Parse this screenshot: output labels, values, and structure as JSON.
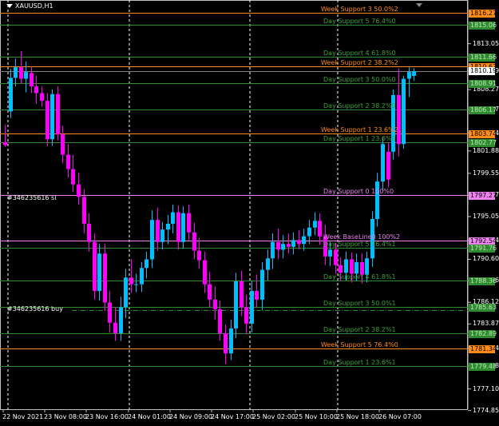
{
  "symbol": "XAUUSD,H1",
  "colors": {
    "background": "#000000",
    "bull": "#00BFFF",
    "bear": "#FF00FF",
    "week": "#FF8C1A",
    "day": "#2E8B2E",
    "pivot": "#EE82EE",
    "grid": "#FFFFFF"
  },
  "order_labels": {
    "sl": "#346235616 sl",
    "buy": "#346235616 buy"
  },
  "levels": [
    {
      "label": "Week Support 3 50.0%2",
      "price": "1816.27",
      "kind": "week"
    },
    {
      "label": "Day Support 5 76.4%0",
      "price": "1815.06",
      "kind": "day"
    },
    {
      "label": "Day Support 4 61.8%0",
      "price": "1811.66",
      "kind": "day"
    },
    {
      "label": "Week Support 2 38.2%2",
      "price": "1810.67",
      "kind": "week"
    },
    {
      "label": "Day Support 3 50.0%0",
      "price": "1808.91",
      "kind": "day"
    },
    {
      "label": "Day Support 2 38.2%0",
      "price": "1806.17",
      "kind": "day"
    },
    {
      "label": "Week Support 1 23.6%2",
      "price": "1803.74",
      "kind": "week"
    },
    {
      "label": "Day Support 1 23.6%0",
      "price": "1802.77",
      "kind": "day"
    },
    {
      "label": "Day Support 0 100%0",
      "price": "1797.27",
      "kind": "pivot"
    },
    {
      "label": "Week BaseLine0 100%2",
      "price": "1792.54",
      "kind": "pivot"
    },
    {
      "label": "Day Support 5 76.4%1",
      "price": "1791.76",
      "kind": "day"
    },
    {
      "label": "Day Support 4 61.8%1",
      "price": "1788.36",
      "kind": "day"
    },
    {
      "label": "Day Support 3 50.0%1",
      "price": "1785.63",
      "kind": "day"
    },
    {
      "label": "Day Support 2 38.2%1",
      "price": "1782.89",
      "kind": "day"
    },
    {
      "label": "Week Support 5 76.4%0",
      "price": "1781.34",
      "kind": "week"
    },
    {
      "label": "Day Support 1 23.6%1",
      "price": "1779.48",
      "kind": "day"
    }
  ],
  "current_price": "1810.19",
  "price_axis": [
    "1813.05",
    "1810.19",
    "1808.27",
    "1806.17",
    "1803.74",
    "1801.88",
    "1799.55",
    "1797.27",
    "1795.05",
    "1792.54",
    "1790.60",
    "1788.36",
    "1786.12",
    "1783.87",
    "1781.34",
    "1779.48",
    "1777.10",
    "1774.85"
  ],
  "time_axis": [
    "22 Nov 2021",
    "23 Nov 08:00",
    "23 Nov 16:00",
    "24 Nov 01:00",
    "24 Nov 09:00",
    "24 Nov 17:00",
    "25 Nov 02:00",
    "25 Nov 10:00",
    "25 Nov 18:00",
    "26 Nov 07:00"
  ],
  "chart_data": {
    "type": "candlestick",
    "symbol": "XAUUSD,H1",
    "candles": [
      {
        "o": 1802.8,
        "h": 1804.6,
        "l": 1802.3,
        "c": 1802.5
      },
      {
        "o": 1806.0,
        "h": 1810.4,
        "l": 1805.3,
        "c": 1809.5
      },
      {
        "o": 1809.5,
        "h": 1811.5,
        "l": 1808.6,
        "c": 1810.6
      },
      {
        "o": 1810.6,
        "h": 1812.3,
        "l": 1808.9,
        "c": 1809.4
      },
      {
        "o": 1809.4,
        "h": 1811.2,
        "l": 1808.0,
        "c": 1810.1
      },
      {
        "o": 1810.0,
        "h": 1810.6,
        "l": 1807.9,
        "c": 1808.6
      },
      {
        "o": 1808.6,
        "h": 1809.7,
        "l": 1806.8,
        "c": 1807.9
      },
      {
        "o": 1807.9,
        "h": 1808.6,
        "l": 1806.5,
        "c": 1807.1
      },
      {
        "o": 1807.1,
        "h": 1807.9,
        "l": 1802.4,
        "c": 1803.1
      },
      {
        "o": 1803.1,
        "h": 1808.3,
        "l": 1802.4,
        "c": 1807.8
      },
      {
        "o": 1807.8,
        "h": 1808.6,
        "l": 1803.0,
        "c": 1803.6
      },
      {
        "o": 1803.6,
        "h": 1804.5,
        "l": 1800.6,
        "c": 1801.5
      },
      {
        "o": 1801.5,
        "h": 1802.6,
        "l": 1799.1,
        "c": 1800.0
      },
      {
        "o": 1800.0,
        "h": 1801.5,
        "l": 1797.6,
        "c": 1798.4
      },
      {
        "o": 1798.4,
        "h": 1799.6,
        "l": 1796.3,
        "c": 1797.1
      },
      {
        "o": 1797.1,
        "h": 1797.9,
        "l": 1793.3,
        "c": 1794.3
      },
      {
        "o": 1794.3,
        "h": 1795.4,
        "l": 1791.4,
        "c": 1792.4
      },
      {
        "o": 1792.4,
        "h": 1793.3,
        "l": 1786.4,
        "c": 1787.3
      },
      {
        "o": 1787.3,
        "h": 1792.2,
        "l": 1786.3,
        "c": 1791.2
      },
      {
        "o": 1791.2,
        "h": 1792.2,
        "l": 1785.2,
        "c": 1786.1
      },
      {
        "o": 1786.1,
        "h": 1787.3,
        "l": 1783.0,
        "c": 1784.0
      },
      {
        "o": 1784.0,
        "h": 1785.6,
        "l": 1782.1,
        "c": 1782.9
      },
      {
        "o": 1782.9,
        "h": 1786.7,
        "l": 1782.1,
        "c": 1785.6
      },
      {
        "o": 1785.6,
        "h": 1789.6,
        "l": 1784.5,
        "c": 1788.7
      },
      {
        "o": 1788.7,
        "h": 1790.6,
        "l": 1787.1,
        "c": 1788.0
      },
      {
        "o": 1788.0,
        "h": 1789.1,
        "l": 1787.2,
        "c": 1788.0
      },
      {
        "o": 1788.0,
        "h": 1790.3,
        "l": 1787.2,
        "c": 1789.7
      },
      {
        "o": 1789.7,
        "h": 1791.4,
        "l": 1788.6,
        "c": 1790.6
      },
      {
        "o": 1790.6,
        "h": 1795.7,
        "l": 1789.7,
        "c": 1794.7
      },
      {
        "o": 1794.7,
        "h": 1796.0,
        "l": 1791.5,
        "c": 1792.4
      },
      {
        "o": 1792.4,
        "h": 1794.5,
        "l": 1791.6,
        "c": 1793.7
      },
      {
        "o": 1793.7,
        "h": 1795.2,
        "l": 1792.2,
        "c": 1794.3
      },
      {
        "o": 1794.3,
        "h": 1796.3,
        "l": 1793.3,
        "c": 1795.5
      },
      {
        "o": 1795.5,
        "h": 1796.2,
        "l": 1791.6,
        "c": 1792.4
      },
      {
        "o": 1792.4,
        "h": 1796.1,
        "l": 1791.7,
        "c": 1795.4
      },
      {
        "o": 1795.4,
        "h": 1796.3,
        "l": 1792.6,
        "c": 1793.4
      },
      {
        "o": 1793.4,
        "h": 1794.4,
        "l": 1790.6,
        "c": 1791.5
      },
      {
        "o": 1791.5,
        "h": 1792.8,
        "l": 1789.6,
        "c": 1790.5
      },
      {
        "o": 1790.5,
        "h": 1791.4,
        "l": 1787.1,
        "c": 1788.0
      },
      {
        "o": 1788.0,
        "h": 1789.3,
        "l": 1785.6,
        "c": 1786.4
      },
      {
        "o": 1786.4,
        "h": 1787.8,
        "l": 1784.3,
        "c": 1785.4
      },
      {
        "o": 1785.4,
        "h": 1786.3,
        "l": 1782.1,
        "c": 1782.9
      },
      {
        "o": 1782.9,
        "h": 1783.8,
        "l": 1779.7,
        "c": 1780.8
      },
      {
        "o": 1780.8,
        "h": 1784.3,
        "l": 1780.1,
        "c": 1783.4
      },
      {
        "o": 1783.4,
        "h": 1789.2,
        "l": 1782.4,
        "c": 1788.3
      },
      {
        "o": 1788.3,
        "h": 1789.4,
        "l": 1784.7,
        "c": 1785.6
      },
      {
        "o": 1785.6,
        "h": 1786.9,
        "l": 1782.8,
        "c": 1783.9
      },
      {
        "o": 1783.9,
        "h": 1788.4,
        "l": 1783.0,
        "c": 1787.3
      },
      {
        "o": 1787.3,
        "h": 1789.0,
        "l": 1785.6,
        "c": 1786.4
      },
      {
        "o": 1786.4,
        "h": 1790.3,
        "l": 1785.3,
        "c": 1789.5
      },
      {
        "o": 1789.5,
        "h": 1791.6,
        "l": 1788.4,
        "c": 1790.7
      },
      {
        "o": 1790.7,
        "h": 1793.3,
        "l": 1789.6,
        "c": 1792.4
      },
      {
        "o": 1792.4,
        "h": 1793.8,
        "l": 1790.6,
        "c": 1791.6
      },
      {
        "o": 1791.6,
        "h": 1793.1,
        "l": 1790.7,
        "c": 1792.2
      },
      {
        "o": 1792.2,
        "h": 1793.3,
        "l": 1791.2,
        "c": 1791.9
      },
      {
        "o": 1791.9,
        "h": 1793.4,
        "l": 1791.1,
        "c": 1792.6
      },
      {
        "o": 1792.6,
        "h": 1793.6,
        "l": 1791.6,
        "c": 1792.2
      },
      {
        "o": 1792.2,
        "h": 1793.8,
        "l": 1791.5,
        "c": 1793.0
      },
      {
        "o": 1793.0,
        "h": 1794.7,
        "l": 1792.2,
        "c": 1793.9
      },
      {
        "o": 1793.9,
        "h": 1795.5,
        "l": 1793.1,
        "c": 1794.6
      },
      {
        "o": 1794.6,
        "h": 1795.4,
        "l": 1792.1,
        "c": 1793.0
      },
      {
        "o": 1793.0,
        "h": 1794.2,
        "l": 1790.0,
        "c": 1790.9
      },
      {
        "o": 1790.9,
        "h": 1792.4,
        "l": 1789.9,
        "c": 1791.6
      },
      {
        "o": 1791.6,
        "h": 1792.3,
        "l": 1789.1,
        "c": 1790.0
      },
      {
        "o": 1790.0,
        "h": 1790.8,
        "l": 1788.3,
        "c": 1789.2
      },
      {
        "o": 1789.2,
        "h": 1791.4,
        "l": 1788.4,
        "c": 1790.6
      },
      {
        "o": 1790.6,
        "h": 1791.3,
        "l": 1788.2,
        "c": 1789.1
      },
      {
        "o": 1789.1,
        "h": 1791.2,
        "l": 1788.3,
        "c": 1790.3
      },
      {
        "o": 1790.3,
        "h": 1791.2,
        "l": 1788.1,
        "c": 1789.0
      },
      {
        "o": 1789.0,
        "h": 1791.4,
        "l": 1788.2,
        "c": 1790.7
      },
      {
        "o": 1790.7,
        "h": 1795.6,
        "l": 1789.8,
        "c": 1794.8
      },
      {
        "o": 1794.8,
        "h": 1799.6,
        "l": 1794.0,
        "c": 1798.7
      },
      {
        "o": 1798.7,
        "h": 1803.3,
        "l": 1797.8,
        "c": 1802.6
      },
      {
        "o": 1801.8,
        "h": 1802.8,
        "l": 1798.1,
        "c": 1798.9
      },
      {
        "o": 1801.8,
        "h": 1808.3,
        "l": 1801.0,
        "c": 1807.7
      },
      {
        "o": 1807.7,
        "h": 1810.5,
        "l": 1801.3,
        "c": 1802.6
      },
      {
        "o": 1802.6,
        "h": 1809.7,
        "l": 1802.1,
        "c": 1809.4
      },
      {
        "o": 1809.4,
        "h": 1810.6,
        "l": 1807.5,
        "c": 1810.1
      },
      {
        "o": 1809.7,
        "h": 1810.5,
        "l": 1809.2,
        "c": 1810.2
      }
    ]
  }
}
